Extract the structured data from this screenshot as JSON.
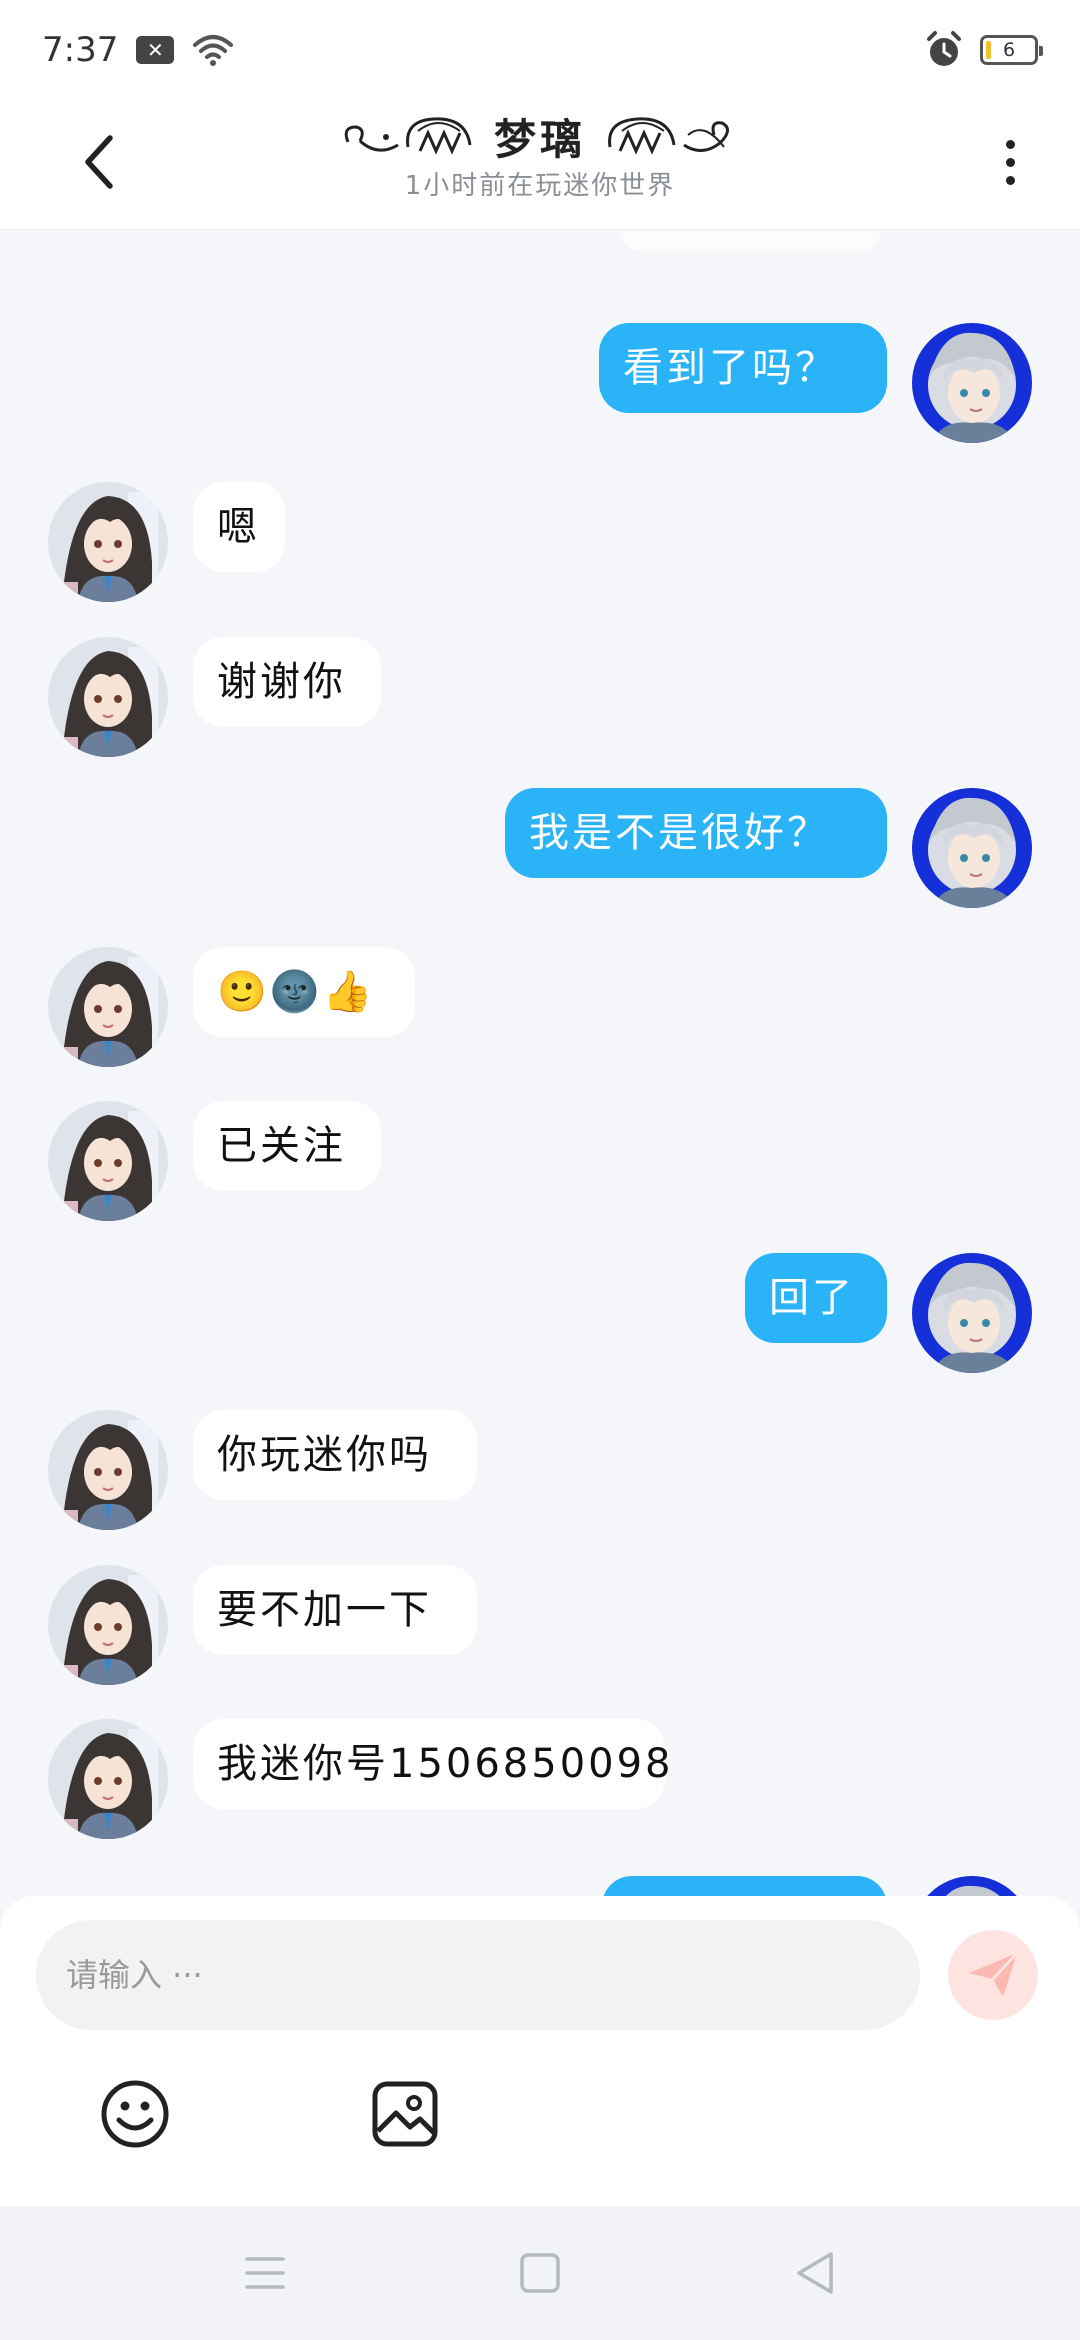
{
  "status": {
    "time": "7:37",
    "battery": "6"
  },
  "header": {
    "title": "梦璃",
    "subtitle": "1小时前在玩迷你世界"
  },
  "messages": [
    {
      "side": "out",
      "text": "看到了吗？"
    },
    {
      "side": "in",
      "text": "嗯"
    },
    {
      "side": "in",
      "text": "谢谢你"
    },
    {
      "side": "out",
      "text": "我是不是很好？"
    },
    {
      "side": "in",
      "text": "🙂🌚👍"
    },
    {
      "side": "in",
      "text": "已关注"
    },
    {
      "side": "out",
      "text": "回了"
    },
    {
      "side": "in",
      "text": "你玩迷你吗"
    },
    {
      "side": "in",
      "text": "要不加一下"
    },
    {
      "side": "in",
      "text": "我迷你号1506850098"
    },
    {
      "side": "out",
      "text": ""
    }
  ],
  "input": {
    "placeholder": "请输入 ···"
  },
  "colors": {
    "outgoing_bubble": "#2ab3f6",
    "incoming_bubble": "#ffffff",
    "send_button": "#fde4e1"
  },
  "icons": {
    "back": "chevron-left-icon",
    "more": "more-vertical-icon",
    "send": "paper-plane-icon",
    "emoji": "smiley-icon",
    "image": "image-icon"
  }
}
